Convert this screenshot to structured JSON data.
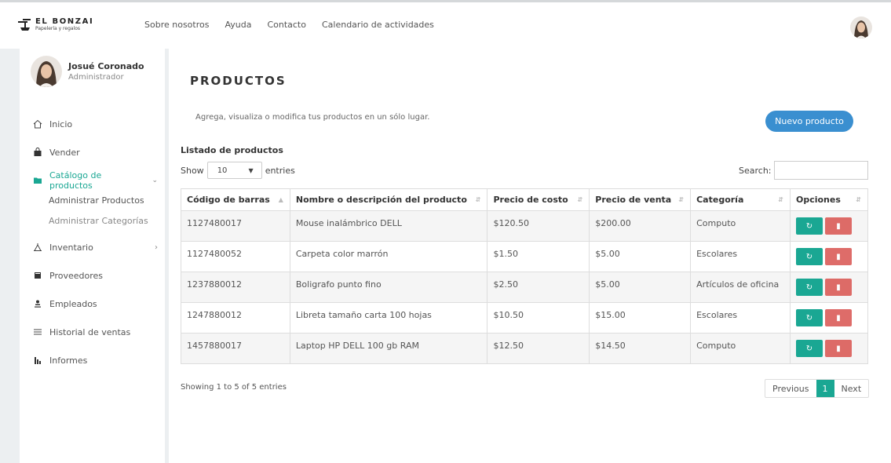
{
  "brand": {
    "name": "EL BONZAI",
    "tagline": "Papelería y regalos"
  },
  "nav": {
    "items": [
      "Sobre nosotros",
      "Ayuda",
      "Contacto",
      "Calendario de actividades"
    ]
  },
  "user": {
    "name": "Josué Coronado",
    "role": "Administrador"
  },
  "sidebar": {
    "items": [
      {
        "label": "Inicio",
        "icon": "home-icon"
      },
      {
        "label": "Vender",
        "icon": "shopping-bag-icon"
      },
      {
        "label": "Catálogo de productos",
        "icon": "folder-icon",
        "active": true
      },
      {
        "label": "Inventario",
        "icon": "inventory-icon"
      },
      {
        "label": "Proveedores",
        "icon": "book-icon"
      },
      {
        "label": "Empleados",
        "icon": "person-icon"
      },
      {
        "label": "Historial de ventas",
        "icon": "list-icon"
      },
      {
        "label": "Informes",
        "icon": "bar-chart-icon"
      }
    ],
    "submenu": [
      "Administrar Productos",
      "Administrar Categorías"
    ]
  },
  "page": {
    "title": "PRODUCTOS",
    "subtitle": "Agrega, visualiza o modifica tus productos en un sólo lugar.",
    "new_button": "Nuevo producto",
    "list_title": "Listado de productos"
  },
  "table_controls": {
    "show_label": "Show",
    "entries_value": "10",
    "entries_label": "entries",
    "search_label": "Search:"
  },
  "table": {
    "columns": [
      "Código de barras",
      "Nombre o descripción del producto",
      "Precio de costo",
      "Precio de venta",
      "Categoría",
      "Opciones"
    ],
    "rows": [
      [
        "1127480017",
        "Mouse inalámbrico DELL",
        "$120.50",
        "$200.00",
        "Computo"
      ],
      [
        "1127480052",
        "Carpeta color marrón",
        "$1.50",
        "$5.00",
        "Escolares"
      ],
      [
        "1237880012",
        "Boligrafo punto fino",
        "$2.50",
        "$5.00",
        "Artículos de oficina"
      ],
      [
        "1247880012",
        "Libreta tamaño carta 100 hojas",
        "$10.50",
        "$15.00",
        "Escolares"
      ],
      [
        "1457880017",
        "Laptop HP DELL 100 gb RAM",
        "$12.50",
        "$14.50",
        "Computo"
      ]
    ]
  },
  "footer": {
    "showing": "Showing 1 to 5 of 5 entries",
    "previous": "Previous",
    "current_page": "1",
    "next": "Next"
  },
  "colors": {
    "accent": "#1aa793",
    "primary_button": "#3a8fd0",
    "danger": "#d9534f"
  }
}
